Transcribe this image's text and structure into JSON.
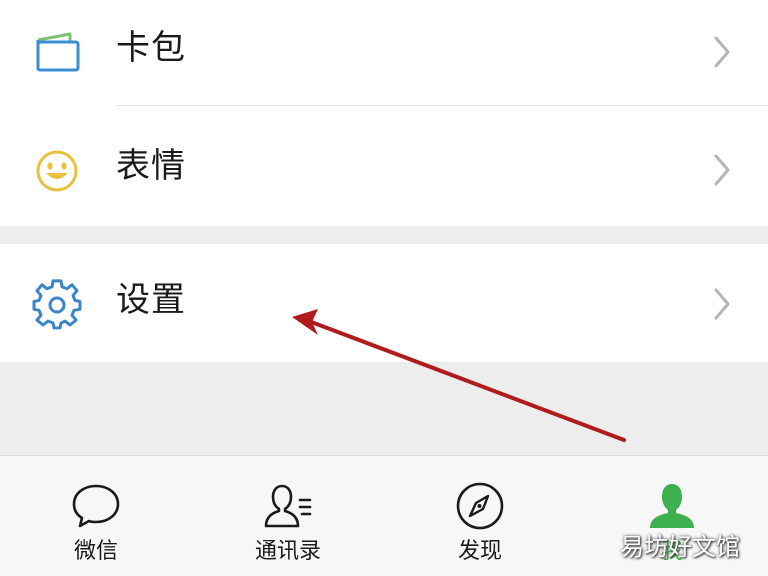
{
  "menu": {
    "card_wallet_label": "卡包",
    "stickers_label": "表情",
    "settings_label": "设置"
  },
  "tabbar": {
    "chats_label": "微信",
    "contacts_label": "通讯录",
    "discover_label": "发现",
    "me_label": "我"
  },
  "watermark": "易坊好文馆",
  "colors": {
    "accent_green": "#3fb050",
    "arrow_red": "#b01c1c",
    "settings_icon_blue": "#3a86c8",
    "emoji_yellow": "#e9c13f"
  }
}
